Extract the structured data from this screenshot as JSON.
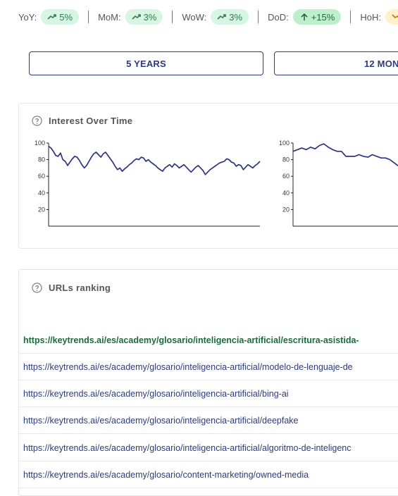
{
  "metrics": [
    {
      "label": "YoY:",
      "value": "5%",
      "trend": "up",
      "icon": "trend-up-icon",
      "variant": "up"
    },
    {
      "label": "MoM:",
      "value": "3%",
      "trend": "up",
      "icon": "trend-up-icon",
      "variant": "up"
    },
    {
      "label": "WoW:",
      "value": "3%",
      "trend": "up",
      "icon": "trend-up-icon",
      "variant": "up"
    },
    {
      "label": "DoD:",
      "value": "+15%",
      "trend": "up",
      "icon": "arrow-up-icon",
      "variant": "dod"
    },
    {
      "label": "HoH:",
      "value": "-",
      "trend": "down",
      "icon": "trend-down-icon",
      "variant": "hoh"
    }
  ],
  "buttons": {
    "five_years": "5 YEARS",
    "twelve_months": "12 MON"
  },
  "interest": {
    "title": "Interest Over Time",
    "help_icon": "help-circle-icon",
    "line_color": "#2d3480",
    "y_ticks": [
      100,
      80,
      60,
      40,
      20
    ],
    "ylim": [
      0,
      100
    ]
  },
  "chart_data": [
    {
      "type": "line",
      "title": "",
      "xlabel": "",
      "ylabel": "",
      "ylim": [
        0,
        100
      ],
      "y_ticks": [
        20,
        40,
        60,
        80,
        100
      ],
      "series": [
        {
          "values": [
            96,
            94,
            90,
            85,
            84,
            88,
            80,
            78,
            73,
            77,
            81,
            84,
            83,
            79,
            74,
            70,
            73,
            78,
            83,
            87,
            89,
            86,
            83,
            87,
            89,
            85,
            81,
            77,
            72,
            68,
            70,
            66,
            69,
            71,
            74,
            76,
            79,
            81,
            80,
            83,
            82,
            78,
            80,
            77,
            75,
            73,
            70,
            68,
            66,
            70,
            72,
            74,
            71,
            75,
            73,
            70,
            72,
            74,
            71,
            68,
            65,
            68,
            71,
            73,
            70,
            67,
            62,
            65,
            68,
            70,
            72,
            74,
            76,
            77,
            78,
            81,
            80,
            77,
            76,
            72,
            74,
            73,
            68,
            71,
            74,
            72,
            70,
            73,
            75,
            78
          ]
        }
      ]
    },
    {
      "type": "line",
      "title": "",
      "xlabel": "",
      "ylabel": "",
      "ylim": [
        0,
        100
      ],
      "y_ticks": [
        20,
        40,
        60,
        80,
        100
      ],
      "series": [
        {
          "values": [
            90,
            92,
            94,
            92,
            95,
            93,
            97,
            99,
            95,
            92,
            90,
            90,
            84,
            84,
            84,
            86,
            84,
            83,
            86,
            84,
            82,
            82,
            80,
            76,
            72
          ]
        }
      ]
    }
  ],
  "urls_card": {
    "title": "URLs ranking",
    "help_icon": "help-circle-icon",
    "rows": [
      "https://keytrends.ai/es/academy/glosario/inteligencia-artificial/escritura-asistida-",
      "https://keytrends.ai/es/academy/glosario/inteligencia-artificial/modelo-de-lenguaje-de",
      "https://keytrends.ai/es/academy/glosario/inteligencia-artificial/bing-ai",
      "https://keytrends.ai/es/academy/glosario/inteligencia-artificial/deepfake",
      "https://keytrends.ai/es/academy/glosario/inteligencia-artificial/algoritmo-de-inteligenc",
      "https://keytrends.ai/es/academy/glosario/content-marketing/owned-media"
    ]
  }
}
